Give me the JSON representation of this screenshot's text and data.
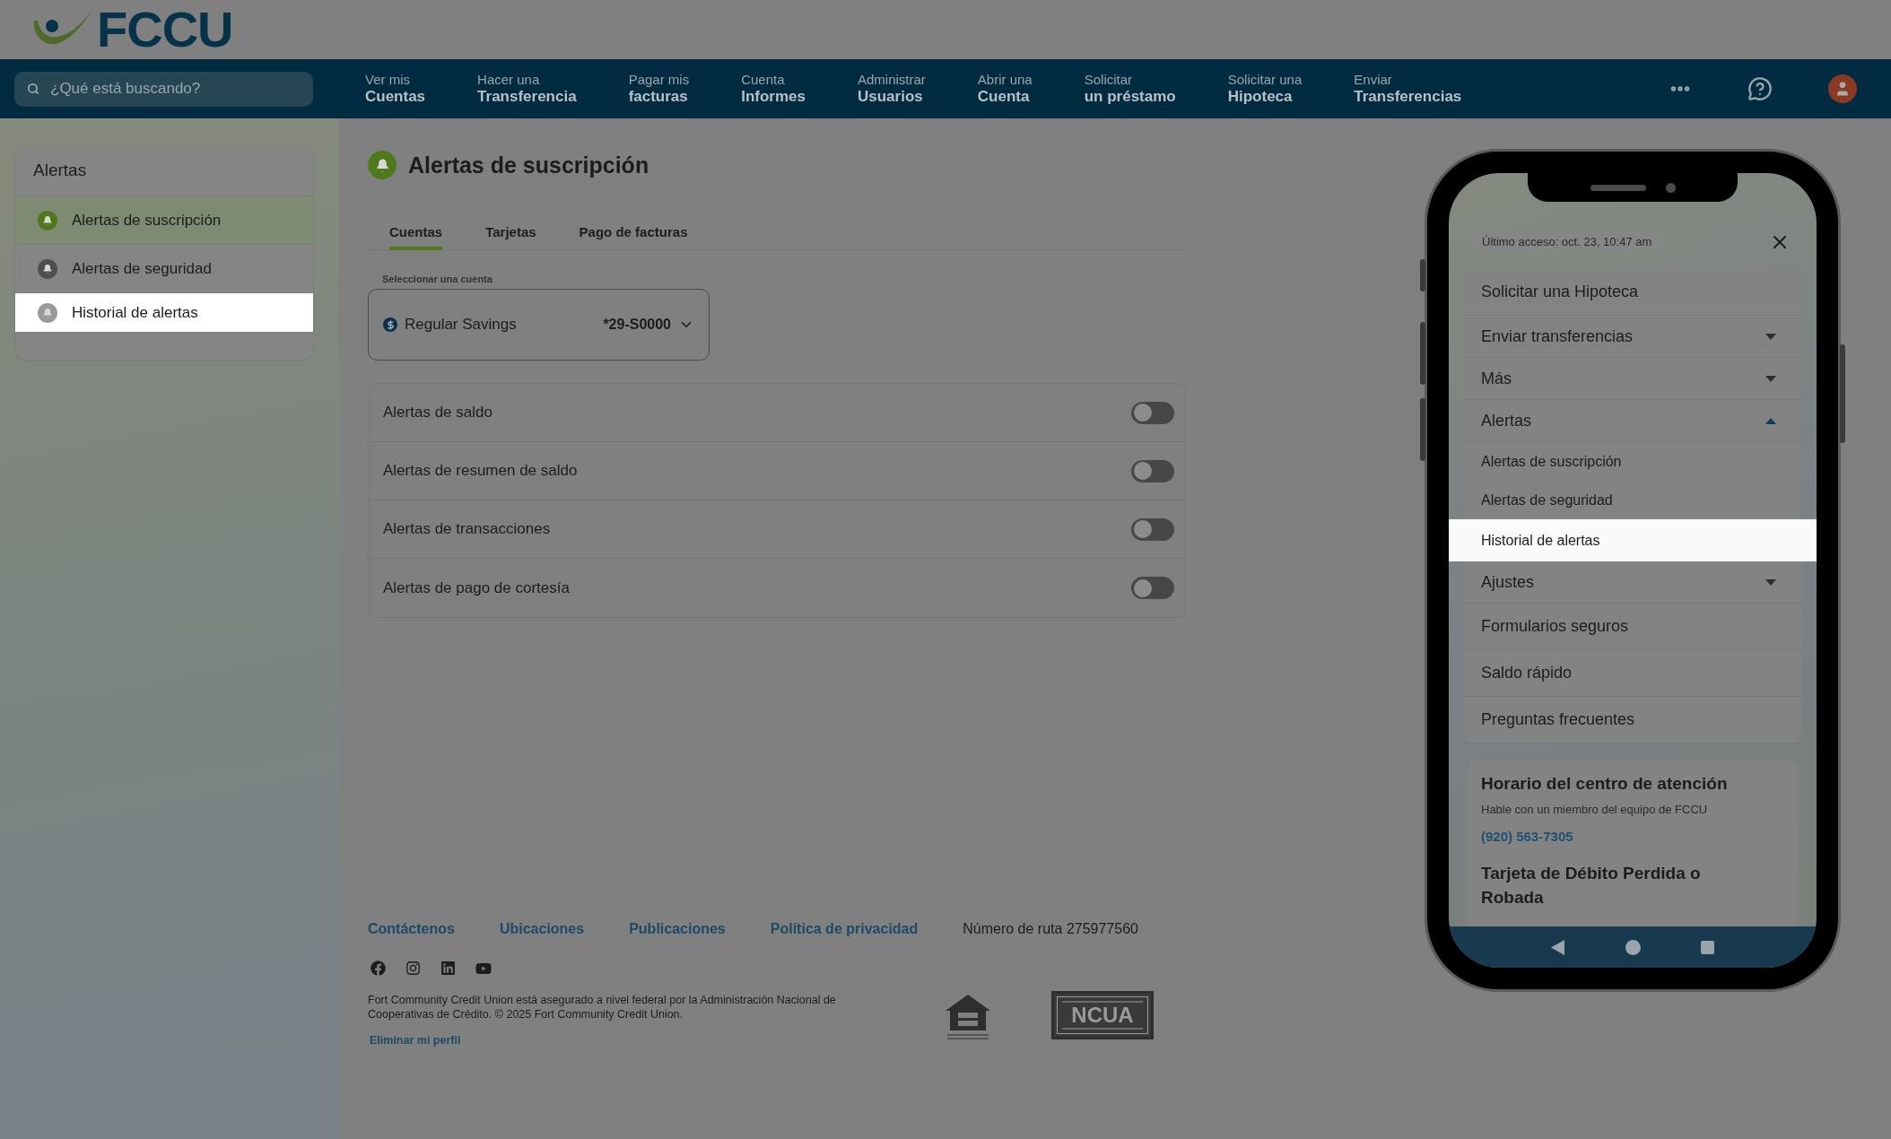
{
  "logo": {
    "text": "FCCU"
  },
  "search": {
    "placeholder": "¿Qué está buscando?"
  },
  "nav": [
    {
      "top": "Ver mis",
      "bottom": "Cuentas"
    },
    {
      "top": "Hacer una",
      "bottom": "Transferencia"
    },
    {
      "top": "Pagar mis",
      "bottom": "facturas"
    },
    {
      "top": "Cuenta",
      "bottom": "Informes"
    },
    {
      "top": "Administrar",
      "bottom": "Usuarios"
    },
    {
      "top": "Abrir una",
      "bottom": "Cuenta"
    },
    {
      "top": "Solicitar",
      "bottom": "un préstamo"
    },
    {
      "top": "Solicitar una",
      "bottom": "Hipoteca"
    },
    {
      "top": "Enviar",
      "bottom": "Transferencias"
    }
  ],
  "sidebar": {
    "title": "Alertas",
    "items": [
      {
        "label": "Alertas de suscripción",
        "selected": true,
        "highlighted": false
      },
      {
        "label": "Alertas de seguridad",
        "selected": false,
        "highlighted": false
      },
      {
        "label": "Historial de alertas",
        "selected": false,
        "highlighted": true
      }
    ]
  },
  "page": {
    "title": "Alertas de suscripción",
    "tabs": [
      {
        "label": "Cuentas",
        "selected": true
      },
      {
        "label": "Tarjetas",
        "selected": false
      },
      {
        "label": "Pago de facturas",
        "selected": false
      }
    ],
    "account_select": {
      "label": "Seleccionar una cuenta",
      "name": "Regular Savings",
      "number": "*29-S0000"
    },
    "alerts": [
      {
        "label": "Alertas de saldo",
        "on": false
      },
      {
        "label": "Alertas de resumen de saldo",
        "on": false
      },
      {
        "label": "Alertas de transacciones",
        "on": false
      },
      {
        "label": "Alertas de pago de cortesía",
        "on": false
      }
    ]
  },
  "footer": {
    "links": [
      "Contáctenos",
      "Ubicaciones",
      "Publicaciones",
      "Política de privacidad"
    ],
    "routing": "Número de ruta 275977560",
    "legal": "Fort Community Credit Union está asegurado a nivel federal por la Administración Nacional de Cooperativas de Crédito. © 2025 Fort Community Credit Union.",
    "delete_profile": "Eliminar mi perfil",
    "ncua_logo": "NCUA"
  },
  "phone": {
    "last_access": "Último acceso: oct. 23, 10:47 am",
    "menu": [
      {
        "label": "Solicitar una Hipoteca",
        "kind": "link"
      },
      {
        "label": "Enviar transferencias",
        "kind": "group",
        "expanded": false
      },
      {
        "label": "Más",
        "kind": "group",
        "expanded": false
      },
      {
        "label": "Alertas",
        "kind": "group",
        "expanded": true,
        "children": [
          {
            "label": "Alertas de suscripción",
            "highlighted": false
          },
          {
            "label": "Alertas de seguridad",
            "highlighted": false
          },
          {
            "label": "Historial de alertas",
            "highlighted": true
          }
        ]
      },
      {
        "label": "Ajustes",
        "kind": "group",
        "expanded": false
      },
      {
        "label": "Formularios seguros",
        "kind": "link"
      },
      {
        "label": "Saldo rápido",
        "kind": "link"
      },
      {
        "label": "Preguntas frecuentes",
        "kind": "link"
      }
    ],
    "support": {
      "title": "Horario del centro de atención",
      "subtitle": "Hable con un miembro del equipo de FCCU",
      "phone": "(920) 563-7305",
      "card_title": "Tarjeta de Débito Perdida o Robada"
    }
  }
}
